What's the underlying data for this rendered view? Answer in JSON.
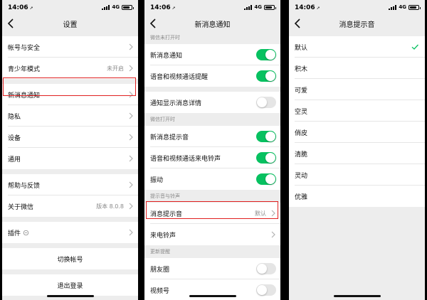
{
  "status": {
    "time": "14:06",
    "network": "4G",
    "battery_level": 0.8
  },
  "screen1": {
    "title": "设置",
    "items": [
      {
        "label": "帐号与安全"
      },
      {
        "label": "青少年模式",
        "value": "未开启"
      },
      {
        "label": "新消息通知"
      },
      {
        "label": "隐私"
      },
      {
        "label": "设备"
      },
      {
        "label": "通用"
      },
      {
        "label": "帮助与反馈"
      },
      {
        "label": "关于微信",
        "value": "版本 8.0.8"
      },
      {
        "label": "插件"
      }
    ],
    "switch_account": "切换帐号",
    "logout": "退出登录"
  },
  "screen2": {
    "title": "新消息通知",
    "section_closed": "微信未打开时",
    "closed_items": [
      {
        "label": "新消息通知",
        "on": true
      },
      {
        "label": "语音和视频通话提醒",
        "on": true
      }
    ],
    "detail_item": {
      "label": "通知显示消息详情",
      "on": false
    },
    "section_open": "微信打开时",
    "open_items": [
      {
        "label": "新消息提示音",
        "on": true
      },
      {
        "label": "语音和视频通话来电铃声",
        "on": true
      },
      {
        "label": "振动",
        "on": true
      }
    ],
    "section_sounds": "提示音与铃声",
    "sound_item": {
      "label": "消息提示音",
      "value": "默认"
    },
    "ringtone_item": {
      "label": "来电铃声"
    },
    "section_updates": "更新提醒",
    "update_items": [
      {
        "label": "朋友圈",
        "on": false
      },
      {
        "label": "视频号",
        "on": false
      }
    ]
  },
  "screen3": {
    "title": "消息提示音",
    "options": [
      "默认",
      "积木",
      "可爱",
      "空灵",
      "俏皮",
      "清脆",
      "灵动",
      "优雅"
    ],
    "selected": "默认"
  },
  "colors": {
    "accent": "#07c160",
    "highlight": "#e02020",
    "background": "#ededed"
  },
  "icons": {
    "back": "chevron-left-icon",
    "chevron": "chevron-right-icon",
    "check": "checkmark-icon",
    "plugin": "plugin-icon"
  }
}
